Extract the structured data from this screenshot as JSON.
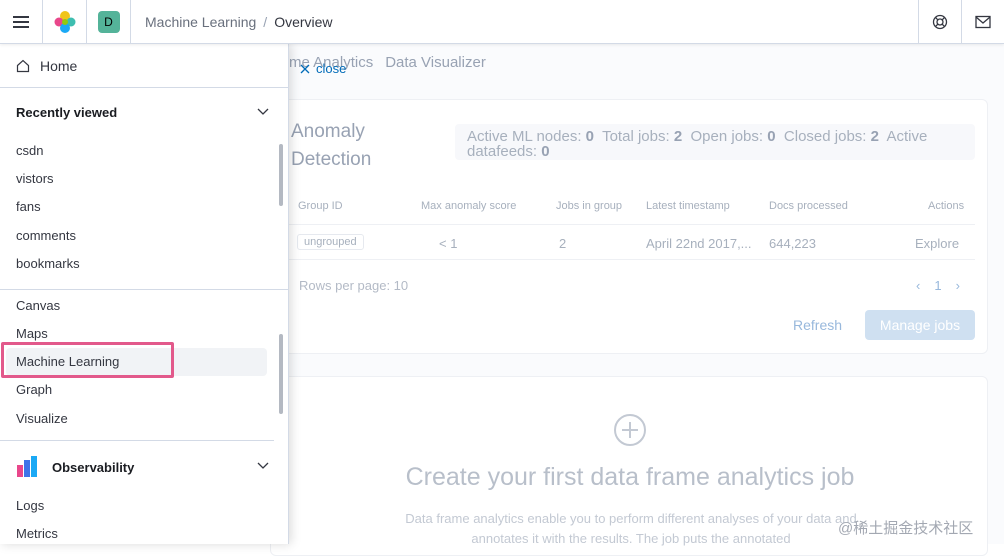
{
  "header": {
    "space_initial": "D",
    "breadcrumb": [
      "Machine Learning",
      "Overview"
    ],
    "breadcrumb_sep": "/"
  },
  "nav": {
    "home": "Home",
    "recently_viewed_title": "Recently viewed",
    "recent_items": [
      "csdn",
      "vistors",
      "fans",
      "comments",
      "bookmarks"
    ],
    "analytics_items": [
      "Canvas",
      "Maps",
      "Machine Learning",
      "Graph",
      "Visualize"
    ],
    "observability_title": "Observability",
    "observability_items": [
      "Logs",
      "Metrics"
    ],
    "highlighted_item": "Machine Learning"
  },
  "app": {
    "tabs": [
      "me Analytics",
      "Data Visualizer"
    ],
    "close_label": "close",
    "anomaly_title": "Anomaly Detection",
    "stats": {
      "active_nodes_label": "Active ML nodes:",
      "active_nodes": "0",
      "total_jobs_label": "Total jobs:",
      "total_jobs": "2",
      "open_jobs_label": "Open jobs:",
      "open_jobs": "0",
      "closed_jobs_label": "Closed jobs:",
      "closed_jobs": "2",
      "active_datafeeds_label": "Active datafeeds:",
      "active_datafeeds": "0"
    },
    "table": {
      "headers": [
        "Group ID",
        "Max anomaly score",
        "Jobs in group",
        "Latest timestamp",
        "Docs processed",
        "Actions"
      ],
      "row": {
        "group": "ungrouped",
        "score": "< 1",
        "jobs": "2",
        "timestamp": "April 22nd 2017,...",
        "docs": "644,223",
        "action": "Explore"
      }
    },
    "rows_per_page": "Rows per page: 10",
    "current_page": "1",
    "refresh": "Refresh",
    "manage_jobs": "Manage jobs",
    "dfa_title": "Create your first data frame analytics job",
    "dfa_body": "Data frame analytics enable you to perform different analyses of your data and annotates it with the results. The job puts the annotated"
  },
  "watermark": "@稀土掘金技术社区",
  "colors": {
    "highlight_box": "#e2598b",
    "accent": "#006bb8",
    "space_badge": "#54b399"
  }
}
